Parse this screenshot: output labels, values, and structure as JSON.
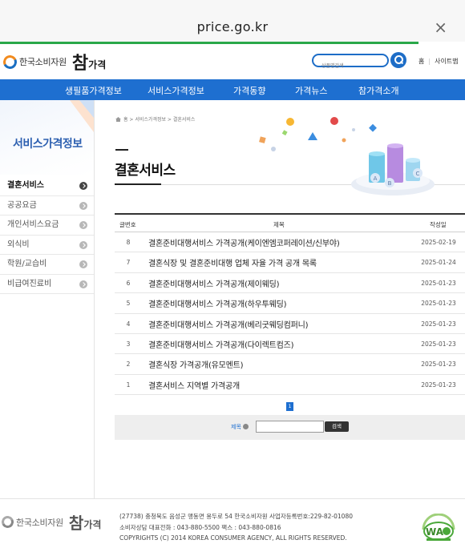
{
  "browser": {
    "url": "price.go.kr",
    "close_label": "×"
  },
  "header": {
    "org_name": "한국소비자원",
    "brand": "참",
    "brand_sub": "가격",
    "search_placeholder": "상품명검색",
    "top_links": [
      "홈",
      "사이트맵"
    ]
  },
  "nav": [
    "생필품가격정보",
    "서비스가격정보",
    "가격동향",
    "가격뉴스",
    "참가격소개"
  ],
  "sidebar": {
    "title": "서비스가격정보",
    "items": [
      {
        "label": "결혼서비스",
        "active": true
      },
      {
        "label": "공공요금",
        "active": false
      },
      {
        "label": "개인서비스요금",
        "active": false
      },
      {
        "label": "외식비",
        "active": false
      },
      {
        "label": "학원/교습비",
        "active": false
      },
      {
        "label": "비급여진료비",
        "active": false
      }
    ]
  },
  "breadcrumb": "홈 > 서비스가격정보 > 결혼서비스",
  "page_title": "결혼서비스",
  "illustration_letters": [
    "A",
    "B",
    "C"
  ],
  "table": {
    "headers": {
      "no": "글번호",
      "subject": "제목",
      "date": "작성일"
    },
    "rows": [
      {
        "no": "8",
        "subject": "결혼준비대행서비스 가격공개(케이엔엠코퍼레이션/신부야)",
        "date": "2025-02-19"
      },
      {
        "no": "7",
        "subject": "결혼식장 및 결혼준비대행 업체 자율 가격 공개 목록",
        "date": "2025-01-24"
      },
      {
        "no": "6",
        "subject": "결혼준비대행서비스 가격공개(제이웨딩)",
        "date": "2025-01-23"
      },
      {
        "no": "5",
        "subject": "결혼준비대행서비스 가격공개(하우투웨딩)",
        "date": "2025-01-23"
      },
      {
        "no": "4",
        "subject": "결혼준비대행서비스 가격공개(베리굿웨딩컴퍼니)",
        "date": "2025-01-23"
      },
      {
        "no": "3",
        "subject": "결혼준비대행서비스 가격공개(다이렉트컴즈)",
        "date": "2025-01-23"
      },
      {
        "no": "2",
        "subject": "결혼식장 가격공개(유모멘트)",
        "date": "2025-01-23"
      },
      {
        "no": "1",
        "subject": "결혼서비스 지역별 가격공개",
        "date": "2025-01-23"
      }
    ]
  },
  "pagination": {
    "current": "1"
  },
  "board_search": {
    "select_label": "제목",
    "button_label": "검색"
  },
  "footer": {
    "lines": [
      "(27738) 충청북도 음성군 맹동면 용두로 54 한국소비자원 사업자등록번호:229-82-01080",
      "소비자상담 대표전화 : 043-880-5500 팩스 : 043-880-0816",
      "COPYRIGHTS (C) 2014 KOREA CONSUMER AGENCY, ALL RIGHTS RESERVED."
    ],
    "badge_text": "WA"
  }
}
